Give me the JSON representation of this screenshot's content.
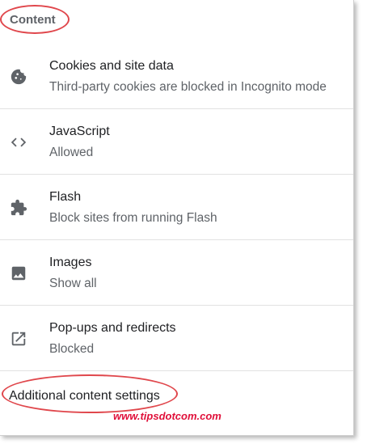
{
  "section": {
    "title": "Content"
  },
  "items": [
    {
      "icon": "cookie-icon",
      "title": "Cookies and site data",
      "subtitle": "Third-party cookies are blocked in Incognito mode"
    },
    {
      "icon": "code-icon",
      "title": "JavaScript",
      "subtitle": "Allowed"
    },
    {
      "icon": "puzzle-piece-icon",
      "title": "Flash",
      "subtitle": "Block sites from running Flash"
    },
    {
      "icon": "image-icon",
      "title": "Images",
      "subtitle": "Show all"
    },
    {
      "icon": "open-in-new-icon",
      "title": "Pop-ups and redirects",
      "subtitle": "Blocked"
    }
  ],
  "additional": {
    "label": "Additional content settings"
  },
  "watermark": "www.tipsdotcom.com",
  "colors": {
    "annotation_red": "#e0474c",
    "watermark_red": "#e0103a",
    "icon_gray": "#5f6368",
    "title_text": "#202124",
    "subtitle_text": "#5f6368"
  }
}
